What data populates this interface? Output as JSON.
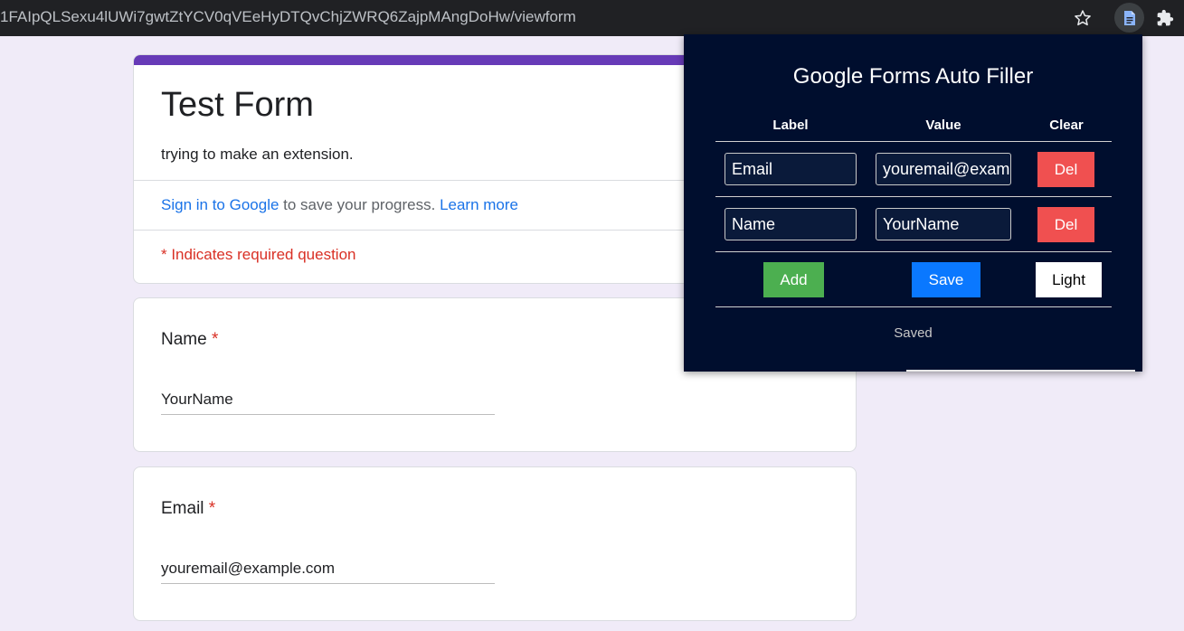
{
  "browser": {
    "url": "1FAIpQLSexu4lUWi7gwtZtYCV0qVEeHyDTQvChjZWRQ6ZajpMAngDoHw/viewform",
    "icons": [
      "star-icon",
      "document-icon",
      "puzzle-icon"
    ]
  },
  "form": {
    "title": "Test Form",
    "description": "trying to make an extension.",
    "signin_link": "Sign in to Google",
    "signin_text": " to save your progress. ",
    "learn_more": "Learn more",
    "required_note": "* Indicates required question",
    "questions": [
      {
        "label": "Name",
        "required_mark": "*",
        "answer": "YourName"
      },
      {
        "label": "Email",
        "required_mark": "*",
        "answer": "youremail@example.com"
      }
    ]
  },
  "popup": {
    "title": "Google Forms Auto Filler",
    "columns": {
      "label": "Label",
      "value": "Value",
      "clear": "Clear"
    },
    "rows": [
      {
        "label": "Email",
        "value": "youremail@example.com",
        "delete": "Del"
      },
      {
        "label": "Name",
        "value": "YourName",
        "delete": "Del"
      }
    ],
    "buttons": {
      "add": "Add",
      "save": "Save",
      "theme": "Light"
    },
    "status": "Saved"
  },
  "colors": {
    "form_accent": "#673ab7",
    "popup_bg": "#000e2e",
    "add": "#4caf50",
    "save": "#0a78ff",
    "delete": "#f05050",
    "required": "#d93025",
    "link": "#1a73e8"
  }
}
